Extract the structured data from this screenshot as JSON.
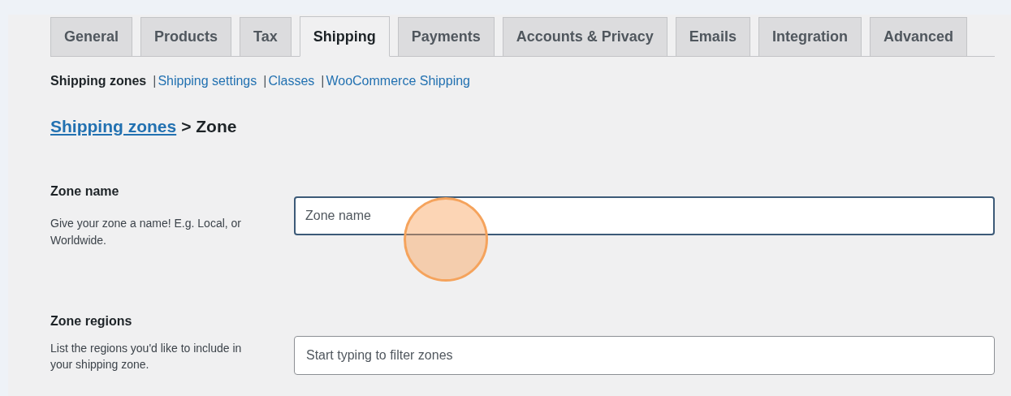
{
  "tabs": [
    {
      "label": "General",
      "selected": false
    },
    {
      "label": "Products",
      "selected": false
    },
    {
      "label": "Tax",
      "selected": false
    },
    {
      "label": "Shipping",
      "selected": true
    },
    {
      "label": "Payments",
      "selected": false
    },
    {
      "label": "Accounts & Privacy",
      "selected": false
    },
    {
      "label": "Emails",
      "selected": false
    },
    {
      "label": "Integration",
      "selected": false
    },
    {
      "label": "Advanced",
      "selected": false
    }
  ],
  "subnav": {
    "separator": "|",
    "items": [
      {
        "label": "Shipping zones",
        "selected": true
      },
      {
        "label": "Shipping settings",
        "selected": false
      },
      {
        "label": "Classes",
        "selected": false
      },
      {
        "label": "WooCommerce Shipping",
        "selected": false
      }
    ]
  },
  "breadcrumb": {
    "link": "Shipping zones",
    "current": "> Zone"
  },
  "fields": [
    {
      "heading": "Zone name",
      "description": "Give your zone a name! E.g. Local, or Worldwide.",
      "placeholder": "Zone name",
      "focused": true
    },
    {
      "heading": "Zone regions",
      "description": "List the regions you'd like to include in your shipping zone.",
      "placeholder": "Start typing to filter zones",
      "focused": false
    }
  ]
}
